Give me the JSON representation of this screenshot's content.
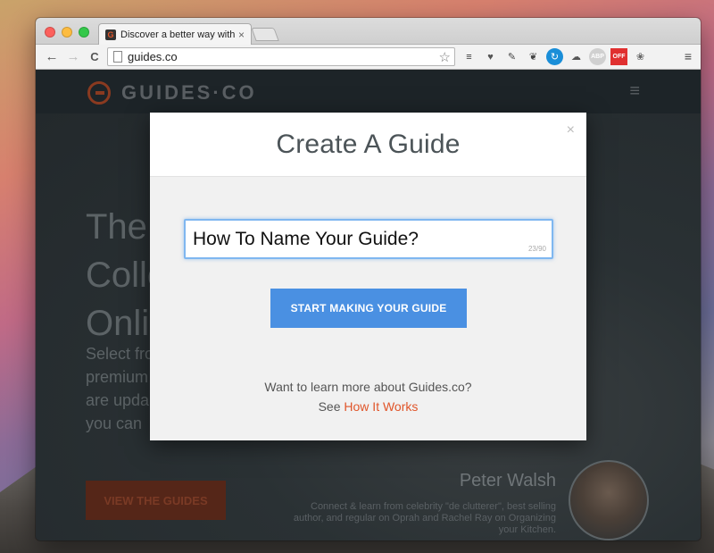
{
  "browser": {
    "tab_title": "Discover a better way with",
    "tab_favicon": "G",
    "tab_close": "×",
    "url": "guides.co",
    "back": "←",
    "forward": "→",
    "reload": "C",
    "star": "☆",
    "extensions": [
      {
        "name": "buffer-icon",
        "glyph": "≡",
        "color": "#333333"
      },
      {
        "name": "pocket-icon",
        "glyph": "♥",
        "color": "#555555"
      },
      {
        "name": "evernote-icon",
        "glyph": "✎",
        "color": "#444444"
      },
      {
        "name": "clip-icon",
        "glyph": "❦",
        "color": "#444444"
      },
      {
        "name": "refresh-ext-icon",
        "glyph": "↻",
        "color": "#1a8ed8"
      },
      {
        "name": "cloud-icon",
        "glyph": "☁",
        "color": "#555555"
      },
      {
        "name": "adblock-icon",
        "glyph": "ABP",
        "color": "#888888"
      },
      {
        "name": "off-icon",
        "glyph": "OFF",
        "color": "#ffffff"
      },
      {
        "name": "film-icon",
        "glyph": "❀",
        "color": "#666666"
      }
    ],
    "menu": "≡"
  },
  "site": {
    "logo_text": "GUIDES·CO",
    "menu_glyph": "≡",
    "hero_title_lines": [
      "The",
      "Colle",
      "Onli"
    ],
    "hero_sub_lines": [
      "Select fro",
      "premium",
      "are upda",
      "you can"
    ],
    "cta": "VIEW THE GUIDES",
    "person_name": "Peter Walsh",
    "person_bio": "Connect & learn from celebrity \"de clutterer\", best selling author, and regular on Oprah and Rachel Ray on Organizing your Kitchen."
  },
  "modal": {
    "title": "Create A Guide",
    "close": "×",
    "input_value": "How To Name Your Guide?",
    "char_count": "23/90",
    "button": "START MAKING YOUR GUIDE",
    "learn_line": "Want to learn more about Guides.co?",
    "see_prefix": "See",
    "see_link": "How It Works"
  },
  "colors": {
    "accent": "#4a90e2",
    "link": "#e0552a",
    "brand": "#e0552a"
  }
}
